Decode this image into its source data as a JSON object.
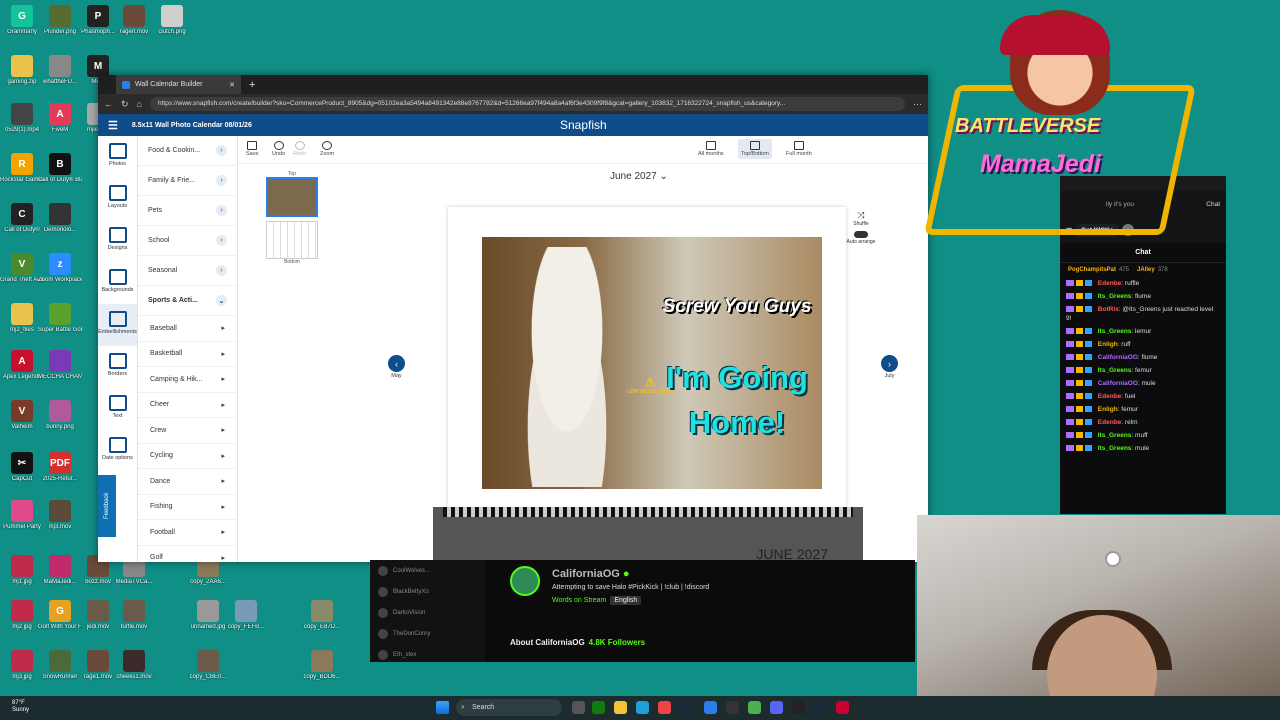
{
  "desktop": {
    "icons": [
      {
        "label": "Grammarly",
        "color": "#15c39a",
        "glyph": "G"
      },
      {
        "label": "Plunder.png",
        "color": "#556b2f",
        "glyph": ""
      },
      {
        "label": "Phasmoph...",
        "color": "#222222",
        "glyph": "P"
      },
      {
        "label": "ragerl.mov",
        "color": "#6b4a3a",
        "glyph": ""
      },
      {
        "label": "clutch.png",
        "color": "#cfcfcf",
        "glyph": ""
      },
      {
        "label": "gaming.zip",
        "color": "#e8c24a",
        "glyph": ""
      },
      {
        "label": "whattheFU...",
        "color": "#888888",
        "glyph": ""
      },
      {
        "label": "Me...",
        "color": "#222222",
        "glyph": "M"
      },
      {
        "label": "0529(1).mp4",
        "color": "#444444",
        "glyph": ""
      },
      {
        "label": "FiveM",
        "color": "#e23b5a",
        "glyph": "A"
      },
      {
        "label": "mjlevit...",
        "color": "#aaaaaa",
        "glyph": ""
      },
      {
        "label": "Rockstar Games ...",
        "color": "#f4a300",
        "glyph": "R"
      },
      {
        "label": "Call of Duty® Bla...",
        "color": "#111111",
        "glyph": "B"
      },
      {
        "label": "Call of Duty®",
        "color": "#222222",
        "glyph": "C"
      },
      {
        "label": "Demonolo...",
        "color": "#333333",
        "glyph": ""
      },
      {
        "label": "Grand Theft Auto V Le...",
        "color": "#4a8a2a",
        "glyph": "V"
      },
      {
        "label": "Zoom Workplace",
        "color": "#2d8cff",
        "glyph": "z"
      },
      {
        "label": "mj2_files",
        "color": "#e8c24a",
        "glyph": ""
      },
      {
        "label": "Super Battle Golf",
        "color": "#5aa02c",
        "glyph": ""
      },
      {
        "label": "Apex Legends",
        "color": "#c8102e",
        "glyph": "A"
      },
      {
        "label": "MECCHA CHAMELE...",
        "color": "#7a3ab8",
        "glyph": ""
      },
      {
        "label": "Valheim",
        "color": "#7a3a2a",
        "glyph": "V"
      },
      {
        "label": "bunny.png",
        "color": "#b05a9a",
        "glyph": ""
      },
      {
        "label": "CapCut",
        "color": "#111111",
        "glyph": "✂"
      },
      {
        "label": "2025-Retur...",
        "color": "#d32f2f",
        "glyph": "PDF"
      },
      {
        "label": "Pummel Party",
        "color": "#e04a8a",
        "glyph": ""
      },
      {
        "label": "mj3.mov",
        "color": "#5a4a3a",
        "glyph": ""
      },
      {
        "label": "mj1.jpg",
        "color": "#c02a4a",
        "glyph": ""
      },
      {
        "label": "MaMaJedi...",
        "color": "#c02a6a",
        "glyph": ""
      },
      {
        "label": "bozz.mov",
        "color": "#6a4a3a",
        "glyph": ""
      },
      {
        "label": "MediaTVCa...",
        "color": "#888888",
        "glyph": ""
      },
      {
        "label": "copy_2AA6...",
        "color": "#8a7a5a",
        "glyph": ""
      },
      {
        "label": "mj2.jpg",
        "color": "#c02a4a",
        "glyph": ""
      },
      {
        "label": "Golf With Your Friends",
        "color": "#e8a020",
        "glyph": "G"
      },
      {
        "label": "jedi.mov",
        "color": "#6a5a4a",
        "glyph": ""
      },
      {
        "label": "turtle.mov",
        "color": "#6a5a4a",
        "glyph": ""
      },
      {
        "label": "unnamed.jpg",
        "color": "#999999",
        "glyph": ""
      },
      {
        "label": "copy_FEFB...",
        "color": "#7a9aba",
        "glyph": ""
      },
      {
        "label": "copy_E87D...",
        "color": "#8a8a6a",
        "glyph": ""
      },
      {
        "label": "mj3.jpg",
        "color": "#c02a4a",
        "glyph": ""
      },
      {
        "label": "SnowRunner",
        "color": "#4a6a3a",
        "glyph": ""
      },
      {
        "label": "rage1.mov",
        "color": "#6a4a3a",
        "glyph": ""
      },
      {
        "label": "cheeks1.mov",
        "color": "#3a2a2a",
        "glyph": ""
      },
      {
        "label": "copy_CBE0...",
        "color": "#6a5a4a",
        "glyph": ""
      },
      {
        "label": "copy_BDD6...",
        "color": "#8a7a5a",
        "glyph": ""
      }
    ]
  },
  "browser": {
    "tab_title": "Wall Calendar Builder",
    "url": "https://www.snapfish.com/create/builder?sku=CommerceProduct_8905&dg=05102ea3a5494a8491342e88e8767782&d=51266ea97f494a8a4af6f3e4309f9f8&gcat=gallery_103832_1716322724_snapfish_us&category..."
  },
  "app": {
    "project_title": "8.5x11 Wall Photo Calendar  08/01/26",
    "logo": "Snapfish",
    "retry_label": "Re",
    "rail": [
      {
        "label": "Photos"
      },
      {
        "label": "Layouts"
      },
      {
        "label": "Designs"
      },
      {
        "label": "Backgrounds"
      },
      {
        "label": "Embellishments"
      },
      {
        "label": "Borders"
      },
      {
        "label": "Text"
      },
      {
        "label": "Date options"
      }
    ],
    "feedback": "Feedback",
    "categories": [
      {
        "label": "Food & Cookin..."
      },
      {
        "label": "Family & Frie..."
      },
      {
        "label": "Pets"
      },
      {
        "label": "School"
      },
      {
        "label": "Seasonal"
      },
      {
        "label": "Sports & Acti..."
      }
    ],
    "subcategories": [
      {
        "label": "Baseball"
      },
      {
        "label": "Basketball"
      },
      {
        "label": "Camping & Hik..."
      },
      {
        "label": "Cheer"
      },
      {
        "label": "Crew"
      },
      {
        "label": "Cycling"
      },
      {
        "label": "Dance"
      },
      {
        "label": "Fishing"
      },
      {
        "label": "Football"
      },
      {
        "label": "Golf"
      }
    ],
    "toolbar": {
      "save": "Save",
      "undo": "Undo",
      "redo": "Redo",
      "zoom": "Zoom",
      "all_months": "All months",
      "top_bottom": "Top/Bottom",
      "full_month": "Full month"
    },
    "pages": {
      "top": "Top",
      "bottom": "Bottom"
    },
    "month_selector": "June 2027 ⌄",
    "nav": {
      "prev": "May",
      "next": "July"
    },
    "side_tools": {
      "shuffle": "Shuffle",
      "auto_arrange": "Auto arrange"
    },
    "photo": {
      "caption_top": "Screw You Guys",
      "caption_main": "I'm Going Home!",
      "warning": "LOW RESOLUTION"
    },
    "bottom_month": "JUNE 2027"
  },
  "kick": {
    "following": [
      {
        "name": "CoolWolves..."
      },
      {
        "name": "BlackBettyXo"
      },
      {
        "name": "DarkoVision"
      },
      {
        "name": "TheDonConry"
      },
      {
        "name": "Eth_stex"
      }
    ],
    "channel": "CaliforniaOG",
    "stream_title": "Attempting to save Halo #PickKick | !club | !discord",
    "category": "Words on Stream",
    "language": "English",
    "about": "About CaliforniaOG",
    "followers": "4.8K Followers"
  },
  "chat": {
    "search_text": "lly it's you",
    "tab_label": "Chat",
    "get_kicks": "Get KICKs",
    "header": "Chat",
    "pinned": [
      {
        "name": "PogChampitsPat",
        "count": "475"
      },
      {
        "name": "JAlley",
        "count": "378"
      }
    ],
    "messages": [
      {
        "user": "Edenbe",
        "text": "ruffle",
        "color": "#ff5a5a"
      },
      {
        "user": "Its_Greens",
        "text": "flume",
        "color": "#53fc18"
      },
      {
        "user": "BotRix",
        "text": "@Its_Greens just reached level 9!",
        "color": "#ff5a5a"
      },
      {
        "user": "Its_Greens",
        "text": "lemur",
        "color": "#53fc18"
      },
      {
        "user": "Enligh",
        "text": "ruff",
        "color": "#f5b700"
      },
      {
        "user": "CaliforniaOG",
        "text": "flume",
        "color": "#b06bff"
      },
      {
        "user": "Its_Greens",
        "text": "femur",
        "color": "#53fc18"
      },
      {
        "user": "CaliforniaOG",
        "text": "mule",
        "color": "#b06bff"
      },
      {
        "user": "Edenbe",
        "text": "fuel",
        "color": "#ff5a5a"
      },
      {
        "user": "Enligh",
        "text": "femur",
        "color": "#f5b700"
      },
      {
        "user": "Edenbe",
        "text": "relm",
        "color": "#ff5a5a"
      },
      {
        "user": "Its_Greens",
        "text": "muff",
        "color": "#53fc18"
      },
      {
        "user": "Its_Greens",
        "text": "mule",
        "color": "#53fc18"
      }
    ]
  },
  "overlay": {
    "brand_line1": "BATTLEVERSE",
    "brand_line2": "MamaJedi"
  },
  "taskbar": {
    "temp": "87°F",
    "condition": "Sunny",
    "search": "Search"
  }
}
